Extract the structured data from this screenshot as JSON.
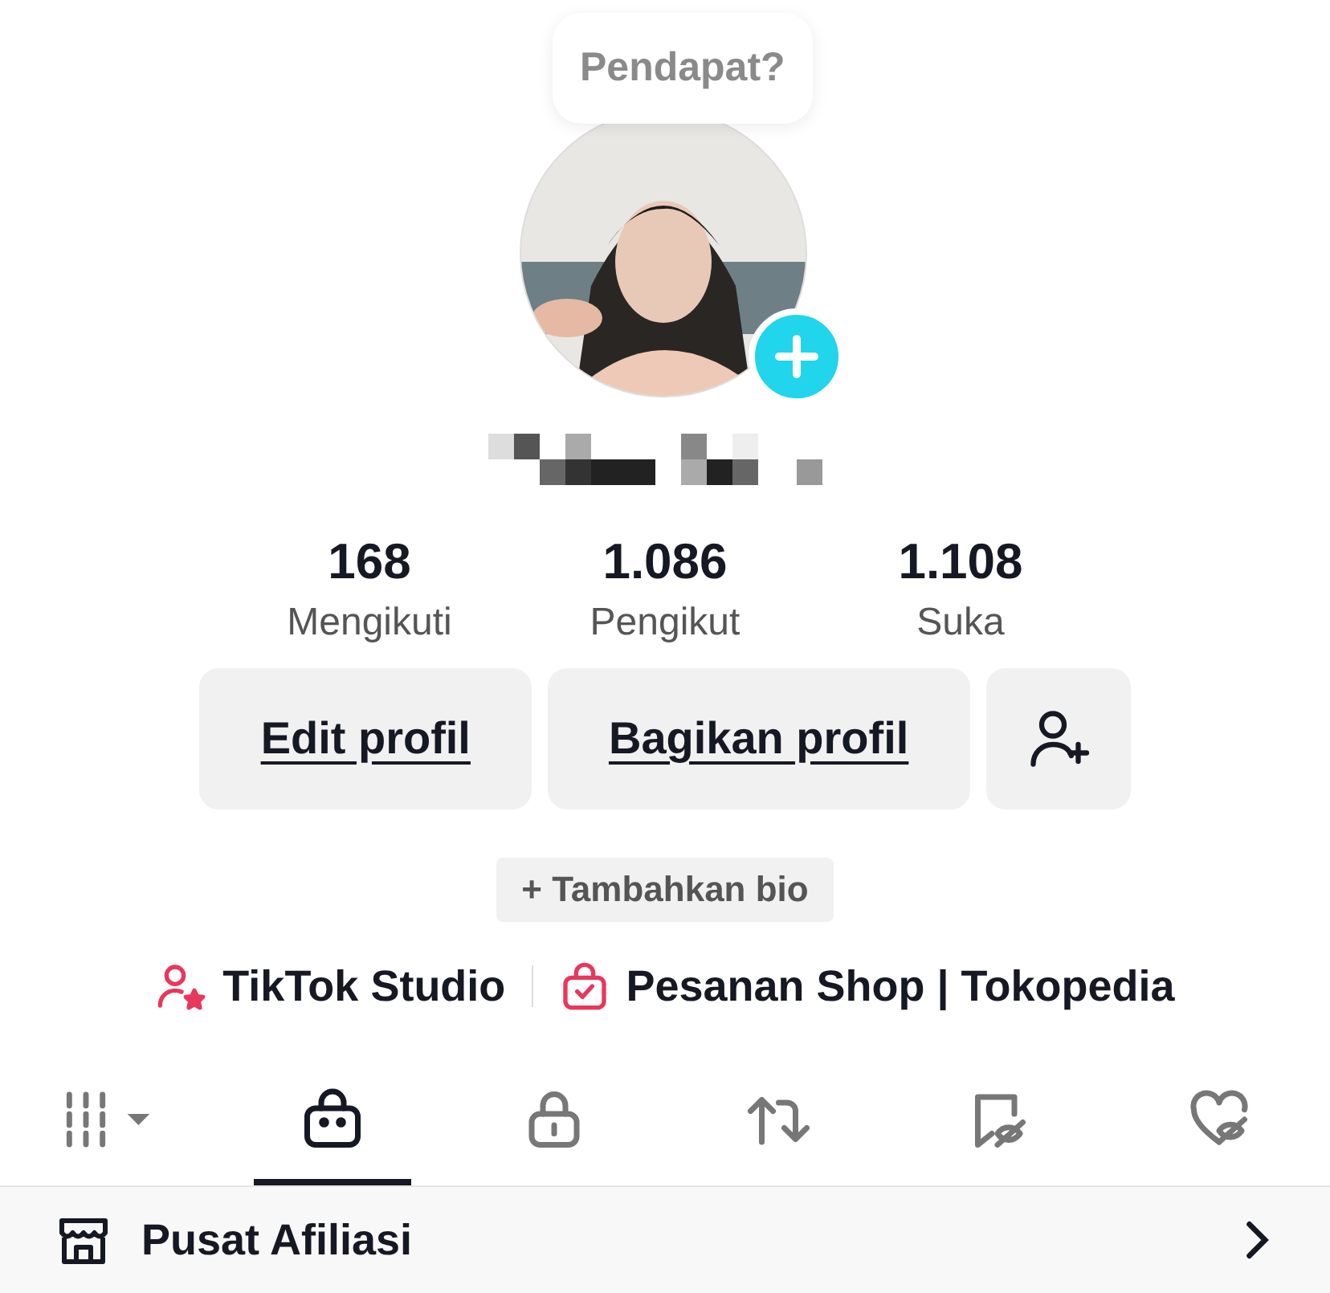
{
  "bubble": {
    "text": "Pendapat?"
  },
  "stats": [
    {
      "value": "168",
      "label": "Mengikuti"
    },
    {
      "value": "1.086",
      "label": "Pengikut"
    },
    {
      "value": "1.108",
      "label": "Suka"
    }
  ],
  "buttons": [
    {
      "kind": "text",
      "label": "Edit profil"
    },
    {
      "kind": "text",
      "label": "Bagikan profil"
    },
    {
      "kind": "add-friend"
    }
  ],
  "bio_button": "+ Tambahkan bio",
  "links": [
    {
      "kind": "studio",
      "label": "TikTok Studio"
    },
    {
      "kind": "shop",
      "label": "Pesanan Shop | Tokopedia"
    }
  ],
  "tabs": [
    {
      "kind": "grid",
      "selected": false
    },
    {
      "kind": "bag",
      "selected": true
    },
    {
      "kind": "lock",
      "selected": false
    },
    {
      "kind": "repost",
      "selected": false
    },
    {
      "kind": "bookmark-hidden",
      "selected": false
    },
    {
      "kind": "heart-hidden",
      "selected": false
    }
  ],
  "affiliate_row": {
    "label": "Pusat Afiliasi"
  }
}
